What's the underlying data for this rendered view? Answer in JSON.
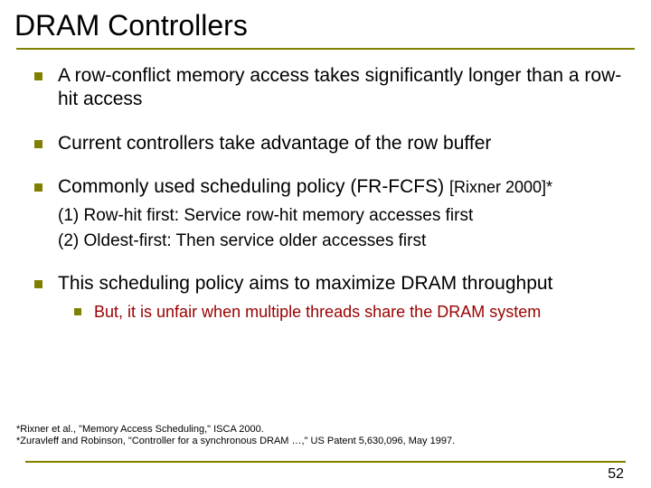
{
  "title": "DRAM Controllers",
  "bullets": {
    "b1": "A row-conflict memory access takes significantly longer than a row-hit access",
    "b2": "Current controllers take advantage of the row buffer",
    "b3_prefix": "Commonly used scheduling policy (FR-FCFS) ",
    "b3_cite": "[Rixner 2000]*",
    "b3_sub1": "(1) Row-hit first: Service row-hit memory accesses first",
    "b3_sub2": "(2) Oldest-first: Then service older accesses first",
    "b4": "This scheduling policy aims to maximize DRAM throughput",
    "b4_sub1_prefix": "But, ",
    "b4_sub1_rest": "it is unfair when multiple threads share the DRAM system"
  },
  "footnotes": {
    "f1": "*Rixner et al., \"Memory Access Scheduling,\" ISCA 2000.",
    "f2": "*Zuravleff and Robinson, \"Controller for a synchronous DRAM …,\" US Patent 5,630,096, May 1997."
  },
  "page_number": "52"
}
